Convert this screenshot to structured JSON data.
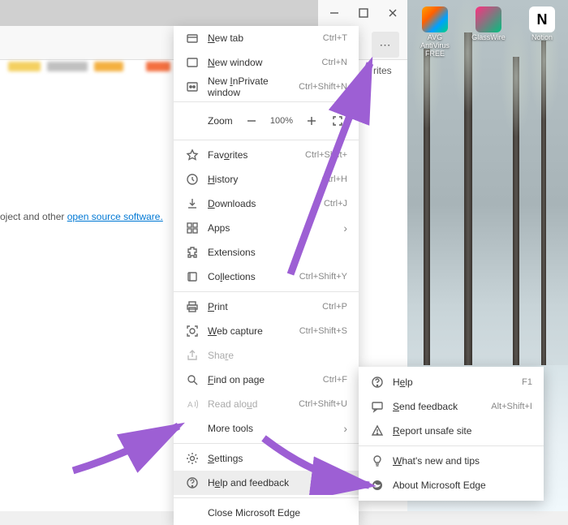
{
  "desktop": {
    "icons": [
      {
        "label": "AVG AntiVirus FREE"
      },
      {
        "label": "GlassWire"
      },
      {
        "label": "Notion"
      }
    ]
  },
  "browser": {
    "favorites_hint": "rites",
    "page_text_prefix": "oject and other ",
    "page_link": "open source software.",
    "more_button": "⋯"
  },
  "menu": {
    "new_tab": {
      "label": "New tab",
      "shortcut": "Ctrl+T"
    },
    "new_window": {
      "label": "New window",
      "shortcut": "Ctrl+N"
    },
    "new_inprivate": {
      "label": "New InPrivate window",
      "shortcut": "Ctrl+Shift+N"
    },
    "zoom": {
      "label": "Zoom",
      "value": "100%"
    },
    "favorites": {
      "label": "Favorites",
      "shortcut": "Ctrl+Shift+"
    },
    "history": {
      "label": "History",
      "shortcut": "Ctrl+H"
    },
    "downloads": {
      "label": "Downloads",
      "shortcut": "Ctrl+J"
    },
    "apps": {
      "label": "Apps"
    },
    "extensions": {
      "label": "Extensions"
    },
    "collections": {
      "label": "Collections",
      "shortcut": "Ctrl+Shift+Y"
    },
    "print": {
      "label": "Print",
      "shortcut": "Ctrl+P"
    },
    "web_capture": {
      "label": "Web capture",
      "shortcut": "Ctrl+Shift+S"
    },
    "share": {
      "label": "Share"
    },
    "find": {
      "label": "Find on page",
      "shortcut": "Ctrl+F"
    },
    "read_aloud": {
      "label": "Read aloud",
      "shortcut": "Ctrl+Shift+U"
    },
    "more_tools": {
      "label": "More tools"
    },
    "settings": {
      "label": "Settings"
    },
    "help": {
      "label": "Help and feedback"
    },
    "close": {
      "label": "Close Microsoft Edge"
    }
  },
  "submenu": {
    "help": {
      "label": "Help",
      "shortcut": "F1"
    },
    "send_feedback": {
      "label": "Send feedback",
      "shortcut": "Alt+Shift+I"
    },
    "report": {
      "label": "Report unsafe site"
    },
    "whats_new": {
      "label": "What's new and tips"
    },
    "about": {
      "label": "About Microsoft Edge"
    }
  },
  "arrow_color": "#9d5fd4"
}
